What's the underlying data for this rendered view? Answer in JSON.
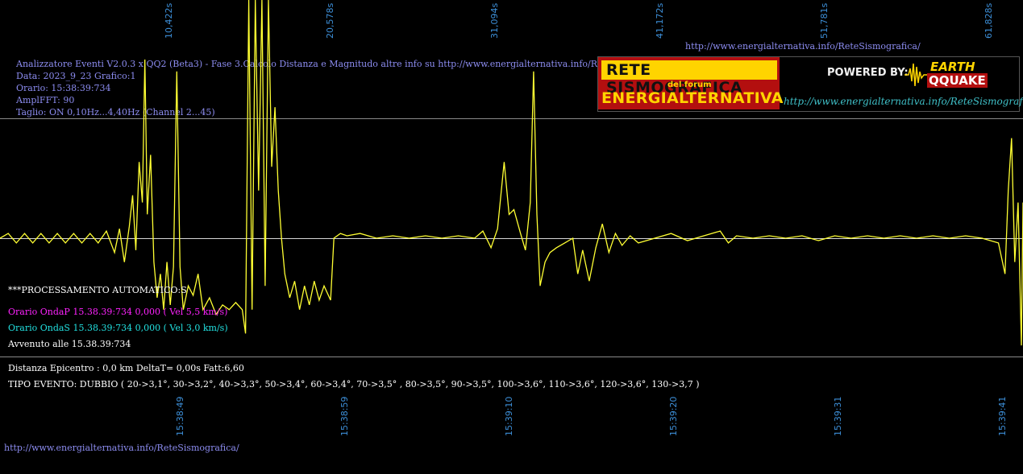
{
  "header_url": "http://www.energialternativa.info/ReteSismografica/",
  "footer_url": "http://www.energialternativa.info/ReteSismografica/",
  "info_lines": [
    "Analizzatore Eventi V2.0.3 x QQ2 (Beta3) - Fase 3.Calcolo Distanza e Magnitudo altre info su http://www.energialternativa.info/ReteSism",
    "Data: 2023_9_23 Grafico:1",
    "Orario: 15:38:39:734",
    "AmplFFT: 90",
    "Taglio: ON 0,10Hz...4,40Hz       (Channel 2...45)"
  ],
  "banner": {
    "title": "RETE SISMOGRAFICA",
    "subtitle": "del forum",
    "name": "ENERGIALTERNATIVA",
    "powered": "POWERED BY:",
    "logo_line1": "EARTH",
    "logo_line2": "QQUAKE",
    "url": "http://www.energialternativa.info/ReteSismografica"
  },
  "processing": {
    "title": "***PROCESSAMENTO AUTOMATICO:S",
    "onda_p": "Orario OndaP 15.38.39:734  0,000 ( Vel 5,5 km/s)",
    "onda_s": "Orario OndaS 15.38.39:734  0,000 ( Vel 3,0 km/s)",
    "avvenuto": "Avvenuto alle 15.38.39:734",
    "distanza": "Distanza Epicentro : 0,0 km DeltaT= 0,00s  Fatt:6,60",
    "tipo_evento": "TIPO EVENTO: DUBBIO ( 20->3,1°, 30->3,2°, 40->3,3°, 50->3,4°, 60->3,4°, 70->3,5° , 80->3,5°, 90->3,5°, 100->3,6°, 110->3,6°, 120->3,6°, 130->3,7 )"
  },
  "colors": {
    "background": "#000000",
    "trace": "#ffff33",
    "tick_label": "#3d8fd8",
    "info_text": "#8c8cf0",
    "onda_p": "#ff22ff",
    "onda_s": "#22e0e0",
    "grid": "#8a8a8a"
  },
  "chart_data": {
    "type": "line",
    "top_axis_ticks": [
      "10,422s",
      "20,578s",
      "31,094s",
      "41,172s",
      "51,781s",
      "61,828s"
    ],
    "bottom_axis_ticks": [
      "15:38:49",
      "15:38:59",
      "15:39:10",
      "15:39:20",
      "15:39:31",
      "15:39:41"
    ],
    "x_range_s": [
      0,
      62.5
    ],
    "y_range": [
      -1,
      1
    ],
    "series": [
      {
        "values": [
          [
            0.0,
            0.0
          ],
          [
            0.5,
            0.02
          ],
          [
            1.0,
            -0.02
          ],
          [
            1.5,
            0.02
          ],
          [
            2.0,
            -0.02
          ],
          [
            2.5,
            0.02
          ],
          [
            3.0,
            -0.02
          ],
          [
            3.5,
            0.02
          ],
          [
            4.0,
            -0.02
          ],
          [
            4.5,
            0.02
          ],
          [
            5.0,
            -0.02
          ],
          [
            5.5,
            0.02
          ],
          [
            6.0,
            -0.02
          ],
          [
            6.5,
            0.03
          ],
          [
            7.0,
            -0.06
          ],
          [
            7.3,
            0.04
          ],
          [
            7.6,
            -0.1
          ],
          [
            7.9,
            0.05
          ],
          [
            8.1,
            0.18
          ],
          [
            8.3,
            -0.05
          ],
          [
            8.5,
            0.32
          ],
          [
            8.7,
            0.15
          ],
          [
            8.85,
            0.75
          ],
          [
            9.0,
            0.1
          ],
          [
            9.2,
            0.35
          ],
          [
            9.4,
            -0.1
          ],
          [
            9.6,
            -0.25
          ],
          [
            9.8,
            -0.15
          ],
          [
            10.0,
            -0.3
          ],
          [
            10.2,
            -0.1
          ],
          [
            10.4,
            -0.28
          ],
          [
            10.6,
            -0.12
          ],
          [
            10.8,
            0.7
          ],
          [
            11.0,
            -0.12
          ],
          [
            11.2,
            -0.3
          ],
          [
            11.5,
            -0.2
          ],
          [
            11.8,
            -0.24
          ],
          [
            12.1,
            -0.15
          ],
          [
            12.4,
            -0.3
          ],
          [
            12.8,
            -0.25
          ],
          [
            13.2,
            -0.32
          ],
          [
            13.6,
            -0.28
          ],
          [
            14.0,
            -0.3
          ],
          [
            14.4,
            -0.27
          ],
          [
            14.8,
            -0.3
          ],
          [
            15.0,
            -0.4
          ],
          [
            15.2,
            1.0
          ],
          [
            15.4,
            -0.3
          ],
          [
            15.6,
            1.0
          ],
          [
            15.8,
            0.2
          ],
          [
            16.0,
            1.0
          ],
          [
            16.2,
            -0.2
          ],
          [
            16.4,
            1.0
          ],
          [
            16.6,
            0.3
          ],
          [
            16.8,
            0.55
          ],
          [
            17.0,
            0.2
          ],
          [
            17.2,
            0.0
          ],
          [
            17.4,
            -0.15
          ],
          [
            17.7,
            -0.25
          ],
          [
            18.0,
            -0.18
          ],
          [
            18.3,
            -0.3
          ],
          [
            18.6,
            -0.2
          ],
          [
            18.9,
            -0.28
          ],
          [
            19.2,
            -0.18
          ],
          [
            19.5,
            -0.26
          ],
          [
            19.8,
            -0.2
          ],
          [
            20.2,
            -0.26
          ],
          [
            20.4,
            0.0
          ],
          [
            20.8,
            0.02
          ],
          [
            21.2,
            0.01
          ],
          [
            22.0,
            0.02
          ],
          [
            23.0,
            0.0
          ],
          [
            24.0,
            0.01
          ],
          [
            25.0,
            0.0
          ],
          [
            26.0,
            0.01
          ],
          [
            27.0,
            0.0
          ],
          [
            28.0,
            0.01
          ],
          [
            29.0,
            0.0
          ],
          [
            29.5,
            0.03
          ],
          [
            30.0,
            -0.04
          ],
          [
            30.4,
            0.04
          ],
          [
            30.8,
            0.32
          ],
          [
            31.1,
            0.1
          ],
          [
            31.4,
            0.12
          ],
          [
            31.8,
            0.02
          ],
          [
            32.1,
            -0.05
          ],
          [
            32.4,
            0.15
          ],
          [
            32.6,
            0.7
          ],
          [
            32.8,
            0.1
          ],
          [
            33.0,
            -0.2
          ],
          [
            33.3,
            -0.1
          ],
          [
            33.6,
            -0.06
          ],
          [
            34.0,
            -0.04
          ],
          [
            34.5,
            -0.02
          ],
          [
            35.0,
            0.0
          ],
          [
            35.3,
            -0.15
          ],
          [
            35.6,
            -0.05
          ],
          [
            36.0,
            -0.18
          ],
          [
            36.4,
            -0.04
          ],
          [
            36.8,
            0.06
          ],
          [
            37.2,
            -0.06
          ],
          [
            37.6,
            0.02
          ],
          [
            38.0,
            -0.03
          ],
          [
            38.5,
            0.01
          ],
          [
            39.0,
            -0.02
          ],
          [
            40.0,
            0.0
          ],
          [
            41.0,
            0.02
          ],
          [
            42.0,
            -0.01
          ],
          [
            43.0,
            0.01
          ],
          [
            44.0,
            0.03
          ],
          [
            44.5,
            -0.02
          ],
          [
            45.0,
            0.01
          ],
          [
            46.0,
            0.0
          ],
          [
            47.0,
            0.01
          ],
          [
            48.0,
            0.0
          ],
          [
            49.0,
            0.01
          ],
          [
            50.0,
            -0.01
          ],
          [
            51.0,
            0.01
          ],
          [
            52.0,
            0.0
          ],
          [
            53.0,
            0.01
          ],
          [
            54.0,
            0.0
          ],
          [
            55.0,
            0.01
          ],
          [
            56.0,
            0.0
          ],
          [
            57.0,
            0.01
          ],
          [
            58.0,
            0.0
          ],
          [
            59.0,
            0.01
          ],
          [
            60.0,
            0.0
          ],
          [
            61.0,
            -0.02
          ],
          [
            61.4,
            -0.15
          ],
          [
            61.6,
            0.2
          ],
          [
            61.8,
            0.42
          ],
          [
            62.0,
            -0.1
          ],
          [
            62.2,
            0.15
          ],
          [
            62.4,
            -0.45
          ],
          [
            62.5,
            0.15
          ]
        ]
      }
    ]
  }
}
